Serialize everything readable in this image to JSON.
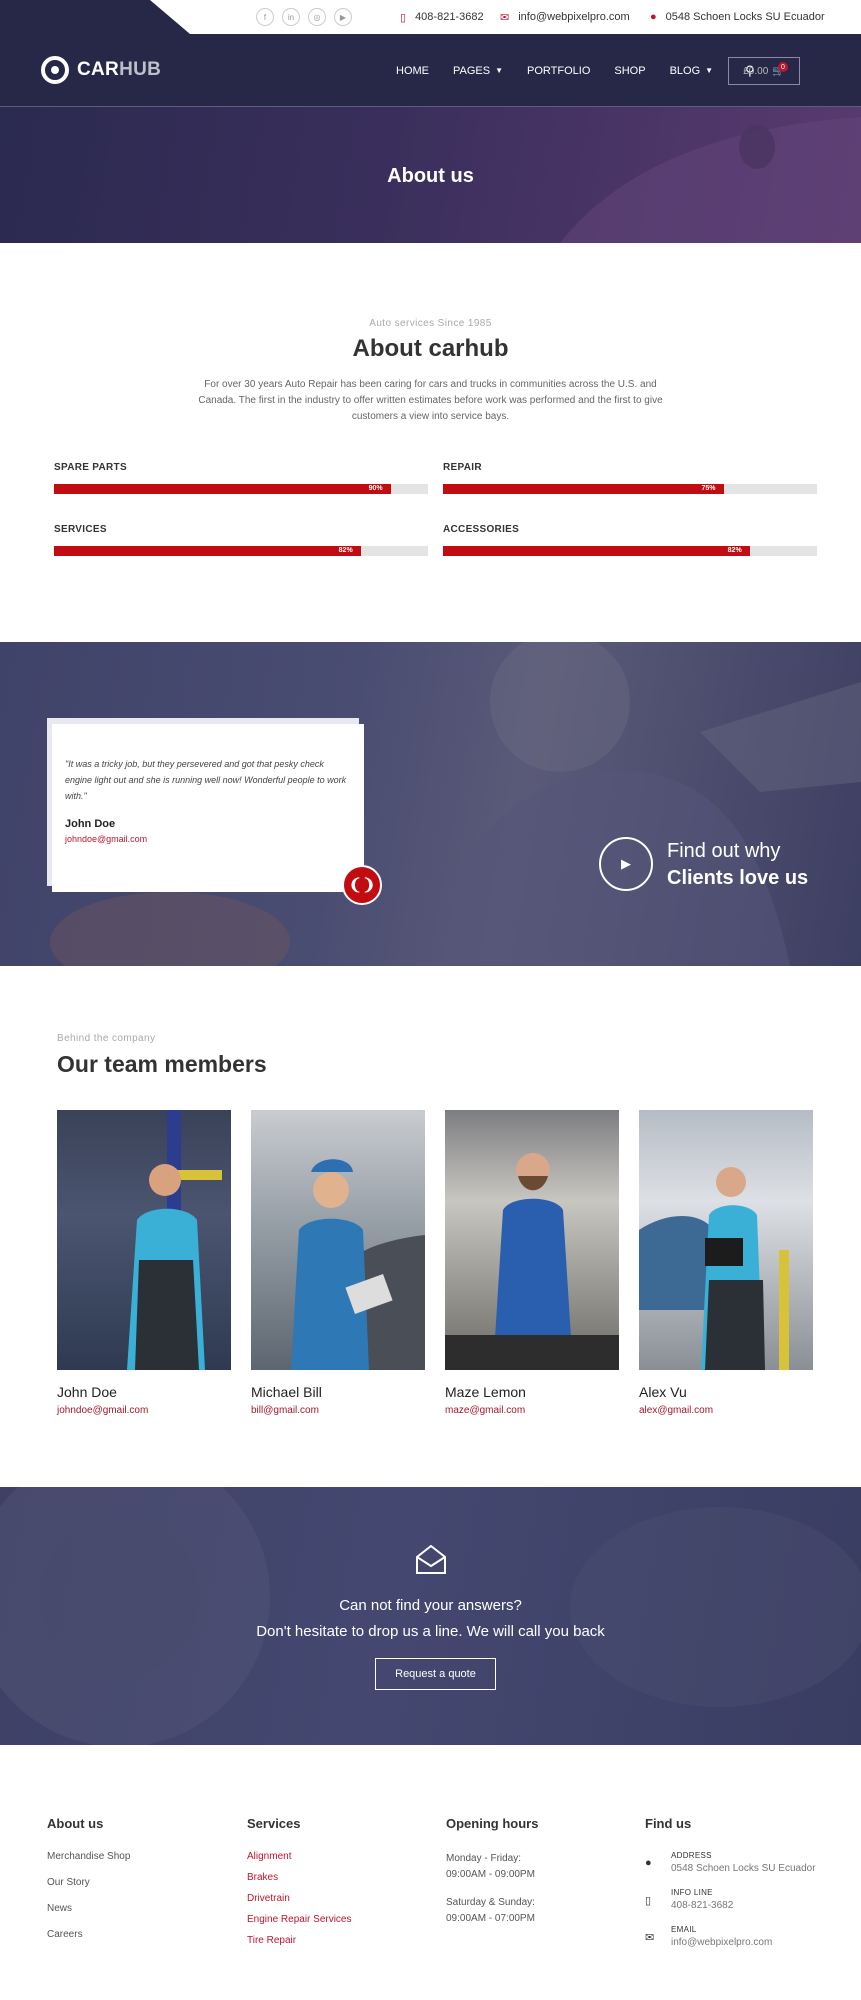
{
  "topbar": {
    "socials": [
      "facebook-icon",
      "linkedin-icon",
      "instagram-icon",
      "youtube-icon"
    ],
    "phone": "408-821-3682",
    "email": "info@webpixelpro.com",
    "address": "0548 Schoen Locks SU Ecuador"
  },
  "header": {
    "logo_strong": "CAR",
    "logo_light": "HUB",
    "nav": [
      "HOME",
      "PAGES",
      "PORTFOLIO",
      "SHOP",
      "BLOG"
    ],
    "cart_total": "£0.00",
    "cart_count": "0"
  },
  "hero": {
    "title": "About us"
  },
  "about": {
    "eyebrow": "Auto services Since 1985",
    "title": "About carhub",
    "description": "For over 30 years Auto Repair has been caring for cars and trucks in communities across the U.S. and Canada. The first in the industry to offer written estimates before work was performed and the first to give customers a view into service bays.",
    "skills": [
      {
        "label": "SPARE PARTS",
        "value": 90,
        "pct": "90%"
      },
      {
        "label": "REPAIR",
        "value": 75,
        "pct": "75%"
      },
      {
        "label": "SERVICES",
        "value": 82,
        "pct": "82%"
      },
      {
        "label": "ACCESSORIES",
        "value": 82,
        "pct": "82%"
      }
    ]
  },
  "testimonial": {
    "quote": "\"It was a tricky job, but they persevered and got that pesky check engine light out and she is running well now! Wonderful people to work with.\"",
    "name": "John Doe",
    "email": "johndoe@gmail.com",
    "cta_line1": "Find out why",
    "cta_line2": "Clients love us"
  },
  "team": {
    "eyebrow": "Behind the company",
    "title": "Our team members",
    "members": [
      {
        "name": "John Doe",
        "email": "johndoe@gmail.com"
      },
      {
        "name": "Michael Bill",
        "email": "bill@gmail.com"
      },
      {
        "name": "Maze Lemon",
        "email": "maze@gmail.com"
      },
      {
        "name": "Alex Vu",
        "email": "alex@gmail.com"
      }
    ]
  },
  "cta": {
    "line1": "Can not find your answers?",
    "line2": "Don't hesitate to drop us a line. We will call you back",
    "button": "Request a quote"
  },
  "footer": {
    "about": {
      "title": "About us",
      "links": [
        "Merchandise Shop",
        "Our Story",
        "News",
        "Careers"
      ]
    },
    "services": {
      "title": "Services",
      "links": [
        "Alignment",
        "Brakes",
        "Drivetrain",
        "Engine Repair Services",
        "Tire Repair"
      ]
    },
    "hours": {
      "title": "Opening hours",
      "weekday_label": "Monday - Friday:",
      "weekday_time": "09:00AM - 09:00PM",
      "weekend_label": "Saturday & Sunday:",
      "weekend_time": "09:00AM - 07:00PM"
    },
    "find": {
      "title": "Find us",
      "address_label": "ADDRESS",
      "address": "0548 Schoen Locks SU Ecuador",
      "phone_label": "INFO LINE",
      "phone": "408-821-3682",
      "email_label": "EMAIL",
      "email": "info@webpixelpro.com"
    }
  },
  "colors": {
    "navy": "#272847",
    "accent_red": "#c10d12",
    "link_red": "#c0152c"
  }
}
